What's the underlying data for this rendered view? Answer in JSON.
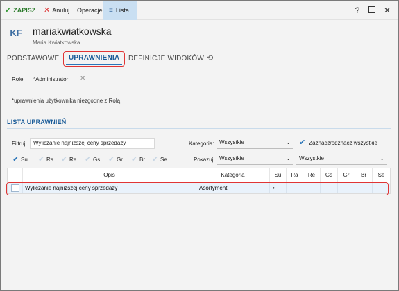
{
  "toolbar": {
    "save_label": "ZAPISZ",
    "cancel_label": "Anuluj",
    "operations_label": "Operacje",
    "list_label": "Lista"
  },
  "window_controls": {
    "help": "?",
    "close": "✕"
  },
  "header": {
    "avatar_initials": "KF",
    "login": "mariakwiatkowska",
    "full_name": "Maria Kwiatkowska"
  },
  "tabs": [
    {
      "label": "PODSTAWOWE",
      "active": false
    },
    {
      "label": "UPRAWNIENIA",
      "active": true
    },
    {
      "label": "DEFINICJE WIDOKÓW",
      "active": false
    }
  ],
  "role": {
    "label": "Role:",
    "value": "*Administrator"
  },
  "permissions_note": "*uprawnienia użytkownika niezgodne z Rolą",
  "section_title": "LISTA UPRAWNIEŃ",
  "filters": {
    "filter_label": "Filtruj:",
    "filter_value": "Wyliczanie najniższej ceny sprzedaży",
    "category_label": "Kategoria:",
    "category_value": "Wszystkie",
    "toggle_all_label": "Zaznacz/odznacz wszystkie",
    "toggle_all_checked": true,
    "show_label": "Pokazuj:",
    "show_value_1": "Wszystkie",
    "show_value_2": "Wszystkie"
  },
  "right_checkboxes": [
    {
      "label": "Su",
      "checked": true
    },
    {
      "label": "Ra",
      "checked": false
    },
    {
      "label": "Re",
      "checked": false
    },
    {
      "label": "Gs",
      "checked": false
    },
    {
      "label": "Gr",
      "checked": false
    },
    {
      "label": "Br",
      "checked": false
    },
    {
      "label": "Se",
      "checked": false
    }
  ],
  "grid": {
    "columns": [
      "Opis",
      "Kategoria",
      "Su",
      "Ra",
      "Re",
      "Gs",
      "Gr",
      "Br",
      "Se"
    ],
    "rows": [
      {
        "opis": "Wyliczanie najniższej ceny sprzedaży",
        "kategoria": "Asortyment",
        "su": "•",
        "ra": "",
        "re": "",
        "gs": "",
        "gr": "",
        "br": "",
        "se": ""
      }
    ]
  },
  "colors": {
    "accent_blue": "#1a5c99",
    "highlight_red": "#e03535",
    "save_green": "#2b7a2b",
    "cancel_red": "#dd3333"
  }
}
